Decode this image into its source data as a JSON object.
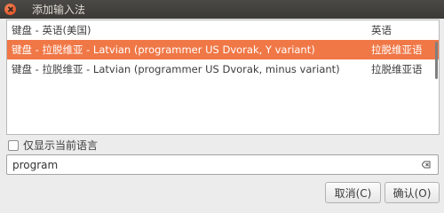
{
  "window": {
    "title": "添加输入法"
  },
  "list": {
    "items": [
      {
        "name": "键盘 - 英语(美国)",
        "language": "英语",
        "selected": false
      },
      {
        "name": "键盘 - 拉脱维亚 - Latvian (programmer US Dvorak, Y variant)",
        "language": "拉脱维亚语",
        "selected": true
      },
      {
        "name": "键盘 - 拉脱维亚 - Latvian (programmer US Dvorak, minus variant)",
        "language": "拉脱维亚语",
        "selected": false
      }
    ]
  },
  "filter": {
    "only_current_language_label": "仅显示当前语言",
    "checked": false
  },
  "search": {
    "value": "program"
  },
  "buttons": {
    "cancel_label": "取消(C)",
    "ok_label": "确认(O)"
  },
  "colors": {
    "selection": "#f07746",
    "titlebar": "#3b3a37",
    "close": "#e2572a"
  },
  "icons": {
    "close": "close-icon",
    "clear": "clear-text-icon"
  }
}
